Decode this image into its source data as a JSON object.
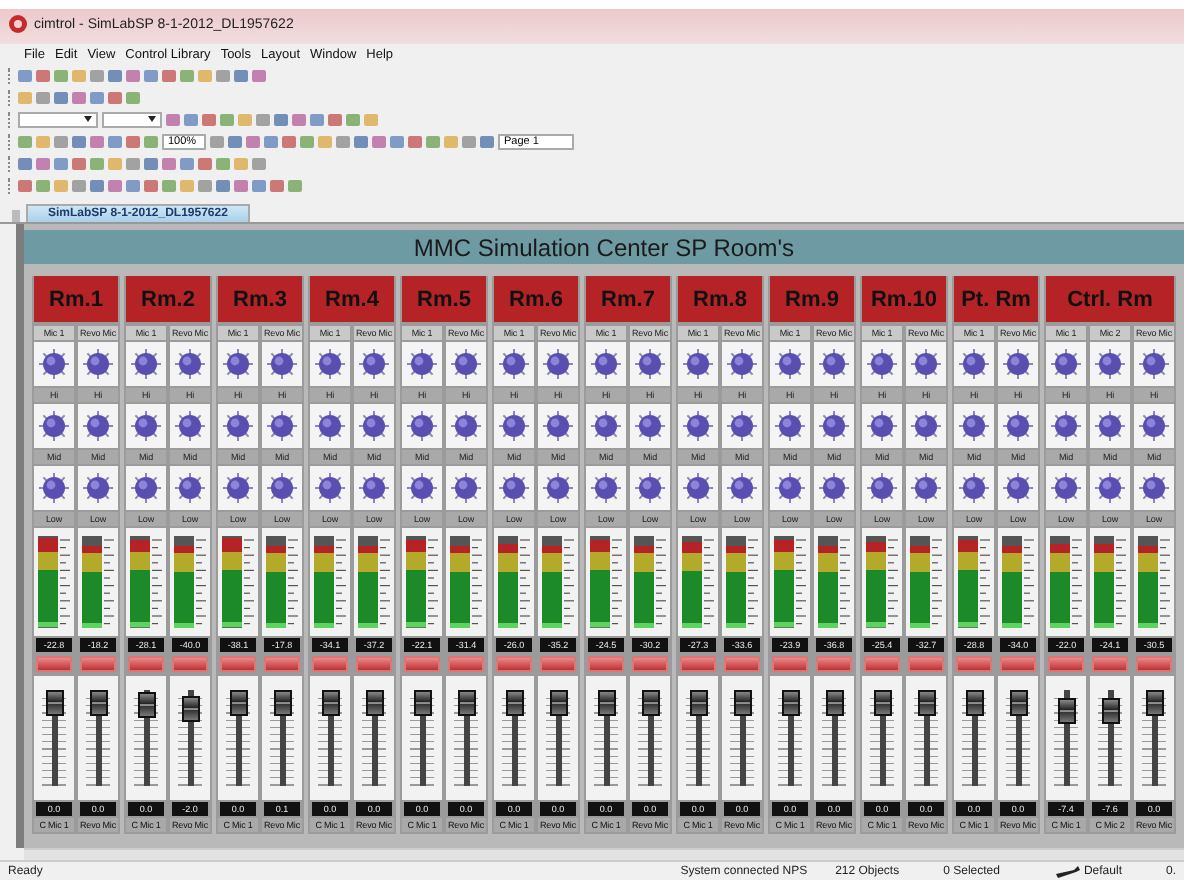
{
  "window": {
    "title": "cimtrol - SimLabSP 8-1-2012_DL1957622"
  },
  "menu": [
    "File",
    "Edit",
    "View",
    "Control Library",
    "Tools",
    "Layout",
    "Window",
    "Help"
  ],
  "toolbar": {
    "zoom": "100%",
    "page": "Page 1"
  },
  "tab": {
    "label": "SimLabSP 8-1-2012_DL1957622",
    "selected": true
  },
  "header": "MMC Simulation Center SP Room's",
  "rooms": [
    {
      "name": "Rm.1",
      "channels": [
        {
          "label": "Mic 1",
          "bands": [
            "Hi",
            "Mid",
            "Low"
          ],
          "meter": {
            "level": 0.97
          },
          "reading": "-22.8",
          "fader": {
            "level": 0.86
          },
          "value": "0.0",
          "name": "C Mic 1"
        },
        {
          "label": "Revo Mic",
          "bands": [
            "Hi",
            "Mid",
            "Low"
          ],
          "meter": {
            "level": 0.9
          },
          "reading": "-18.2",
          "fader": {
            "level": 0.86
          },
          "value": "0.0",
          "name": "Revo Mic"
        }
      ]
    },
    {
      "name": "Rm.2",
      "channels": [
        {
          "label": "Mic 1",
          "bands": [
            "Hi",
            "Mid",
            "Low"
          ],
          "meter": {
            "level": 0.95
          },
          "reading": "-28.1",
          "fader": {
            "level": 0.84
          },
          "value": "0.0",
          "name": "C Mic 1"
        },
        {
          "label": "Revo Mic",
          "bands": [
            "Hi",
            "Mid",
            "Low"
          ],
          "meter": {
            "level": 0.9
          },
          "reading": "-40.0",
          "fader": {
            "level": 0.8
          },
          "value": "-2.0",
          "name": "Revo Mic"
        }
      ]
    },
    {
      "name": "Rm.3",
      "channels": [
        {
          "label": "Mic 1",
          "bands": [
            "Hi",
            "Mid",
            "Low"
          ],
          "meter": {
            "level": 0.97
          },
          "reading": "-38.1",
          "fader": {
            "level": 0.86
          },
          "value": "0.0",
          "name": "C Mic 1"
        },
        {
          "label": "Revo Mic",
          "bands": [
            "Hi",
            "Mid",
            "Low"
          ],
          "meter": {
            "level": 0.9
          },
          "reading": "-17.8",
          "fader": {
            "level": 0.86
          },
          "value": "0.1",
          "name": "Revo Mic"
        }
      ]
    },
    {
      "name": "Rm.4",
      "channels": [
        {
          "label": "Mic 1",
          "bands": [
            "Hi",
            "Mid",
            "Low"
          ],
          "meter": {
            "level": 0.9
          },
          "reading": "-34.1",
          "fader": {
            "level": 0.86
          },
          "value": "0.0",
          "name": "C Mic 1"
        },
        {
          "label": "Revo Mic",
          "bands": [
            "Hi",
            "Mid",
            "Low"
          ],
          "meter": {
            "level": 0.9
          },
          "reading": "-37.2",
          "fader": {
            "level": 0.86
          },
          "value": "0.0",
          "name": "Revo Mic"
        }
      ]
    },
    {
      "name": "Rm.5",
      "channels": [
        {
          "label": "Mic 1",
          "bands": [
            "Hi",
            "Mid",
            "Low"
          ],
          "meter": {
            "level": 0.95
          },
          "reading": "-22.1",
          "fader": {
            "level": 0.86
          },
          "value": "0.0",
          "name": "C Mic 1"
        },
        {
          "label": "Revo Mic",
          "bands": [
            "Hi",
            "Mid",
            "Low"
          ],
          "meter": {
            "level": 0.9
          },
          "reading": "-31.4",
          "fader": {
            "level": 0.86
          },
          "value": "0.0",
          "name": "Revo Mic"
        }
      ]
    },
    {
      "name": "Rm.6",
      "channels": [
        {
          "label": "Mic 1",
          "bands": [
            "Hi",
            "Mid",
            "Low"
          ],
          "meter": {
            "level": 0.92
          },
          "reading": "-26.0",
          "fader": {
            "level": 0.86
          },
          "value": "0.0",
          "name": "C Mic 1"
        },
        {
          "label": "Revo Mic",
          "bands": [
            "Hi",
            "Mid",
            "Low"
          ],
          "meter": {
            "level": 0.9
          },
          "reading": "-35.2",
          "fader": {
            "level": 0.86
          },
          "value": "0.0",
          "name": "Revo Mic"
        }
      ]
    },
    {
      "name": "Rm.7",
      "channels": [
        {
          "label": "Mic 1",
          "bands": [
            "Hi",
            "Mid",
            "Low"
          ],
          "meter": {
            "level": 0.95
          },
          "reading": "-24.5",
          "fader": {
            "level": 0.86
          },
          "value": "0.0",
          "name": "C Mic 1"
        },
        {
          "label": "Revo Mic",
          "bands": [
            "Hi",
            "Mid",
            "Low"
          ],
          "meter": {
            "level": 0.9
          },
          "reading": "-30.2",
          "fader": {
            "level": 0.86
          },
          "value": "0.0",
          "name": "Revo Mic"
        }
      ]
    },
    {
      "name": "Rm.8",
      "channels": [
        {
          "label": "Mic 1",
          "bands": [
            "Hi",
            "Mid",
            "Low"
          ],
          "meter": {
            "level": 0.94
          },
          "reading": "-27.3",
          "fader": {
            "level": 0.86
          },
          "value": "0.0",
          "name": "C Mic 1"
        },
        {
          "label": "Revo Mic",
          "bands": [
            "Hi",
            "Mid",
            "Low"
          ],
          "meter": {
            "level": 0.9
          },
          "reading": "-33.6",
          "fader": {
            "level": 0.86
          },
          "value": "0.0",
          "name": "Revo Mic"
        }
      ]
    },
    {
      "name": "Rm.9",
      "channels": [
        {
          "label": "Mic 1",
          "bands": [
            "Hi",
            "Mid",
            "Low"
          ],
          "meter": {
            "level": 0.95
          },
          "reading": "-23.9",
          "fader": {
            "level": 0.86
          },
          "value": "0.0",
          "name": "C Mic 1"
        },
        {
          "label": "Revo Mic",
          "bands": [
            "Hi",
            "Mid",
            "Low"
          ],
          "meter": {
            "level": 0.9
          },
          "reading": "-36.8",
          "fader": {
            "level": 0.86
          },
          "value": "0.0",
          "name": "Revo Mic"
        }
      ]
    },
    {
      "name": "Rm.10",
      "channels": [
        {
          "label": "Mic 1",
          "bands": [
            "Hi",
            "Mid",
            "Low"
          ],
          "meter": {
            "level": 0.93
          },
          "reading": "-25.4",
          "fader": {
            "level": 0.86
          },
          "value": "0.0",
          "name": "C Mic 1"
        },
        {
          "label": "Revo Mic",
          "bands": [
            "Hi",
            "Mid",
            "Low"
          ],
          "meter": {
            "level": 0.9
          },
          "reading": "-32.7",
          "fader": {
            "level": 0.86
          },
          "value": "0.0",
          "name": "Revo Mic"
        }
      ]
    },
    {
      "name": "Pt. Rm",
      "channels": [
        {
          "label": "Mic 1",
          "bands": [
            "Hi",
            "Mid",
            "Low"
          ],
          "meter": {
            "level": 0.95
          },
          "reading": "-28.8",
          "fader": {
            "level": 0.86
          },
          "value": "0.0",
          "name": "C Mic 1"
        },
        {
          "label": "Revo Mic",
          "bands": [
            "Hi",
            "Mid",
            "Low"
          ],
          "meter": {
            "level": 0.9
          },
          "reading": "-34.0",
          "fader": {
            "level": 0.86
          },
          "value": "0.0",
          "name": "Revo Mic"
        }
      ]
    },
    {
      "name": "Ctrl. Rm",
      "channels": [
        {
          "label": "Mic 1",
          "bands": [
            "Hi",
            "Mid",
            "Low"
          ],
          "meter": {
            "level": 0.92
          },
          "reading": "-22.0",
          "fader": {
            "level": 0.78
          },
          "value": "-7.4",
          "name": "C Mic 1"
        },
        {
          "label": "Mic 2",
          "bands": [
            "Hi",
            "Mid",
            "Low"
          ],
          "meter": {
            "level": 0.92
          },
          "reading": "-24.1",
          "fader": {
            "level": 0.78
          },
          "value": "-7.6",
          "name": "C Mic 2"
        },
        {
          "label": "Revo Mic",
          "bands": [
            "Hi",
            "Mid",
            "Low"
          ],
          "meter": {
            "level": 0.9
          },
          "reading": "-30.5",
          "fader": {
            "level": 0.86
          },
          "value": "0.0",
          "name": "Revo Mic"
        }
      ]
    }
  ],
  "status": {
    "left": "Ready",
    "connection": "System connected NPS",
    "objects": "212 Objects",
    "selected": "0 Selected",
    "style": "Default",
    "extra": "0."
  }
}
